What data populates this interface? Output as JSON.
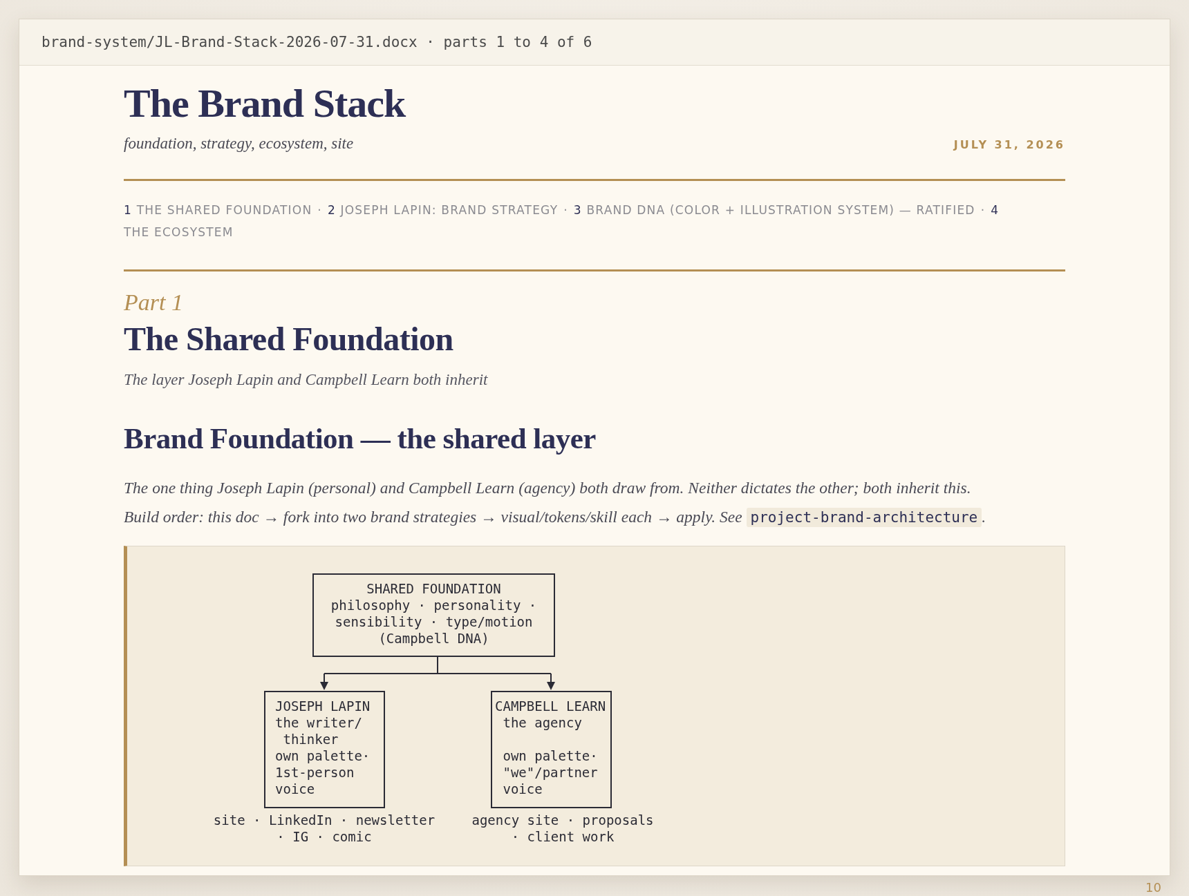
{
  "header": {
    "path": "brand-system/JL-Brand-Stack-2026-07-31.docx · parts 1 to 4 of 6"
  },
  "title": "The Brand Stack",
  "subtitle": "foundation, strategy, ecosystem, site",
  "date": "JULY 31, 2026",
  "toc": {
    "separator": "·",
    "items": [
      {
        "number": "1",
        "label": "THE SHARED FOUNDATION"
      },
      {
        "number": "2",
        "label": "JOSEPH LAPIN: BRAND STRATEGY"
      },
      {
        "number": "3",
        "label": "BRAND DNA (COLOR + ILLUSTRATION SYSTEM) — RATIFIED"
      },
      {
        "number": "4",
        "label": "THE ECOSYSTEM"
      }
    ]
  },
  "part": {
    "kicker": "Part 1",
    "heading": "The Shared Foundation",
    "deck": "The layer Joseph Lapin and Campbell Learn both inherit"
  },
  "section": {
    "heading": "Brand Foundation — the shared layer",
    "lines": [
      "The one thing Joseph Lapin (personal) and Campbell Learn (agency) both draw from. Neither dictates the other; both inherit this.",
      "Build order: this doc → fork into two brand strategies → visual/tokens/skill each → apply. See"
    ],
    "code": "project-brand-architecture",
    "after": "."
  },
  "diagram": {
    "root": {
      "lines": [
        "SHARED FOUNDATION",
        "philosophy · personality ·",
        "sensibility · type/motion",
        "(Campbell DNA)"
      ]
    },
    "branches": [
      {
        "lines": [
          "JOSEPH LAPIN",
          "the writer/",
          " thinker",
          "own palette·",
          "1st-person",
          "voice"
        ],
        "caption": [
          "site · LinkedIn · newsletter",
          "· IG · comic"
        ]
      },
      {
        "lines": [
          "CAMPBELL LEARN",
          " the agency"
        ],
        "lines_after_gap": [
          " own palette·",
          " \"we\"/partner",
          " voice"
        ],
        "caption": [
          "agency site · proposals",
          "· client work"
        ]
      }
    ]
  },
  "page_number": "10"
}
